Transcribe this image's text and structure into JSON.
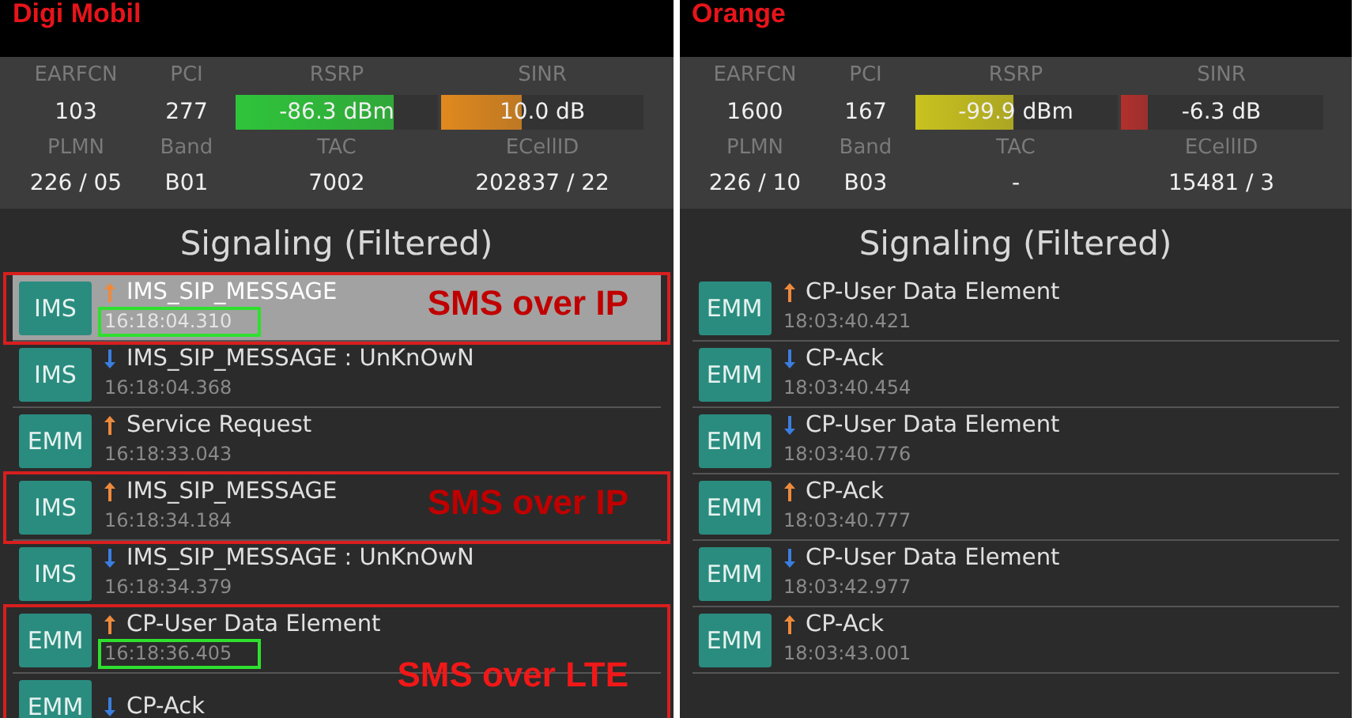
{
  "panels": [
    {
      "carrier": "Digi Mobil",
      "labels": {
        "earfcn": "EARFCN",
        "pci": "PCI",
        "rsrp": "RSRP",
        "sinr": "SINR",
        "plmn": "PLMN",
        "band": "Band",
        "tac": "TAC",
        "ecellid": "ECellID"
      },
      "earfcn": "103",
      "pci": "277",
      "rsrp": {
        "reading": "-86.3 dBm",
        "level": 0.78,
        "color": "#2fc43a"
      },
      "sinr": {
        "reading": "10.0 dB",
        "level": 0.4,
        "color": "#e0891f"
      },
      "plmn": "226 / 05",
      "band": "B01",
      "tac": "7002",
      "ecellid": "202837 / 22",
      "signaling_title": "Signaling (Filtered)",
      "groups": [
        {
          "callout": "SMS over IP",
          "messages": [
            {
              "tag": "IMS",
              "outgoing": true,
              "name": "IMS_SIP_MESSAGE",
              "time": "16:18:04.310",
              "selected": true,
              "time_boxed": true
            }
          ]
        },
        {
          "messages": [
            {
              "tag": "IMS",
              "outgoing": false,
              "name": "IMS_SIP_MESSAGE : UnKnOwN",
              "time": "16:18:04.368",
              "selected": false
            },
            {
              "tag": "EMM",
              "outgoing": true,
              "name": "Service Request",
              "time": "16:18:33.043",
              "selected": false
            }
          ]
        },
        {
          "callout": "SMS over IP",
          "messages": [
            {
              "tag": "IMS",
              "outgoing": true,
              "name": "IMS_SIP_MESSAGE",
              "time": "16:18:34.184",
              "selected": false
            }
          ]
        },
        {
          "messages": [
            {
              "tag": "IMS",
              "outgoing": false,
              "name": "IMS_SIP_MESSAGE : UnKnOwN",
              "time": "16:18:34.379",
              "selected": false
            }
          ]
        },
        {
          "callout": "SMS over LTE",
          "messages": [
            {
              "tag": "EMM",
              "outgoing": true,
              "name": "CP-User Data Element",
              "time": "16:18:36.405",
              "selected": false,
              "time_boxed": true
            },
            {
              "tag": "EMM",
              "outgoing": false,
              "name": "CP-Ack",
              "selected": false
            }
          ]
        }
      ]
    },
    {
      "carrier": "Orange",
      "labels": {
        "earfcn": "EARFCN",
        "pci": "PCI",
        "rsrp": "RSRP",
        "sinr": "SINR",
        "plmn": "PLMN",
        "band": "Band",
        "tac": "TAC",
        "ecellid": "ECellID"
      },
      "earfcn": "1600",
      "pci": "167",
      "rsrp": {
        "reading": "-99.9 dBm",
        "level": 0.49,
        "color": "#c9c21f"
      },
      "sinr": {
        "reading": "-6.3 dB",
        "level": 0.14,
        "color": "#b3302c"
      },
      "plmn": "226 / 10",
      "band": "B03",
      "tac": "-",
      "ecellid": "15481 / 3",
      "signaling_title": "Signaling (Filtered)",
      "groups": [
        {
          "messages": [
            {
              "tag": "EMM",
              "outgoing": true,
              "name": "CP-User Data Element",
              "time": "18:03:40.421",
              "selected": false
            },
            {
              "tag": "EMM",
              "outgoing": false,
              "name": "CP-Ack",
              "time": "18:03:40.454",
              "selected": false
            },
            {
              "tag": "EMM",
              "outgoing": false,
              "name": "CP-User Data Element",
              "time": "18:03:40.776",
              "selected": false
            },
            {
              "tag": "EMM",
              "outgoing": true,
              "name": "CP-Ack",
              "time": "18:03:40.777",
              "selected": false
            },
            {
              "tag": "EMM",
              "outgoing": false,
              "name": "CP-User Data Element",
              "time": "18:03:42.977",
              "selected": false
            },
            {
              "tag": "EMM",
              "outgoing": true,
              "name": "CP-Ack",
              "time": "18:03:43.001",
              "selected": false
            }
          ]
        }
      ]
    }
  ]
}
